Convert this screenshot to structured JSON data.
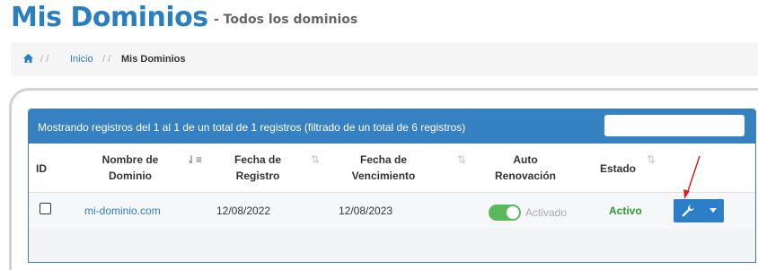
{
  "page": {
    "title": "Mis Dominios",
    "subtitle": "- Todos los dominios"
  },
  "breadcrumb": {
    "sep": "/ /",
    "home_icon": "home-icon",
    "inicio": "Inicio",
    "current": "Mis Dominios"
  },
  "panel": {
    "records_info": "Mostrando registros del 1 al 1 de un total de 1 registros (filtrado de un total de 6 registros)",
    "search_value": ""
  },
  "table": {
    "headers": {
      "id": "ID",
      "domain_line1": "Nombre de",
      "domain_line2": "Dominio",
      "reg_line1": "Fecha de",
      "reg_line2": "Registro",
      "exp_line1": "Fecha de",
      "exp_line2": "Vencimiento",
      "auto_line1": "Auto",
      "auto_line2": "Renovación",
      "status": "Estado"
    },
    "rows": [
      {
        "domain": "mi-dominio.com",
        "registered": "12/08/2022",
        "expires": "12/08/2023",
        "auto_renew_label": "Activado",
        "auto_renew_on": true,
        "status": "Activo"
      }
    ]
  },
  "colors": {
    "primary": "#2a7fbf",
    "header_bg": "#3581c2",
    "toggle_on": "#5cb85c",
    "status_active": "#2d9b2d",
    "arrow": "#d62020"
  }
}
